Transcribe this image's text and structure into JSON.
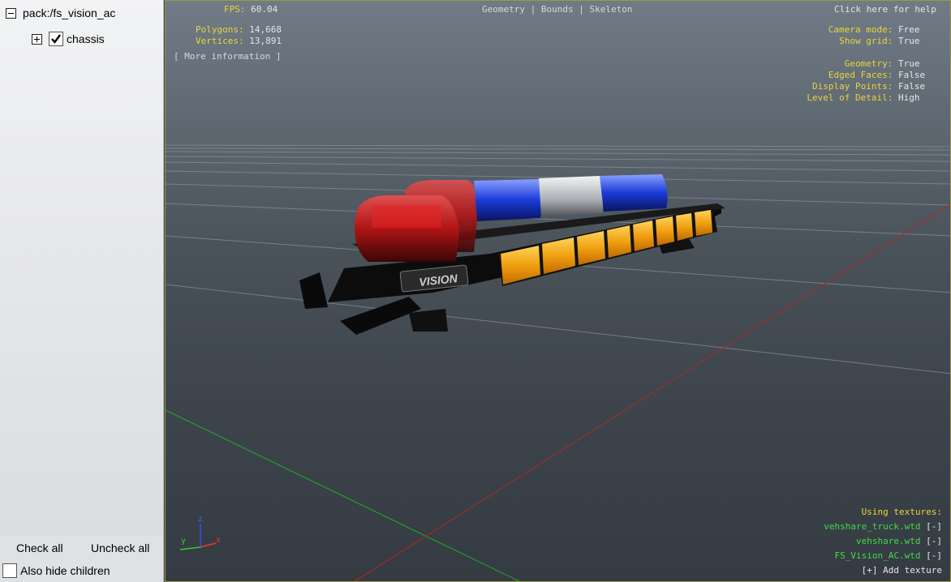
{
  "sidebar": {
    "root_label": "pack:/fs_vision_ac",
    "child_label": "chassis",
    "check_all": "Check all",
    "uncheck_all": "Uncheck all",
    "hide_children": "Also hide children"
  },
  "viewport": {
    "fps_label": "FPS:",
    "fps_value": "60.04",
    "polygons_label": "Polygons:",
    "polygons_value": "14,668",
    "vertices_label": "Vertices:",
    "vertices_value": "13,891",
    "more_info": "[ More information ]",
    "tabs": [
      "Geometry",
      "Bounds",
      "Skeleton"
    ],
    "tab_sep": "|",
    "help": "Click here for help",
    "camera_mode_label": "Camera mode:",
    "camera_mode_value": "Free",
    "show_grid_label": "Show grid:",
    "show_grid_value": "True",
    "geometry_label": "Geometry:",
    "geometry_value": "True",
    "edged_faces_label": "Edged Faces:",
    "edged_faces_value": "False",
    "display_points_label": "Display Points:",
    "display_points_value": "False",
    "lod_label": "Level of Detail:",
    "lod_value": "High",
    "using_textures": "Using textures:",
    "textures": [
      {
        "name": "vehshare_truck.wtd",
        "remove": "[-]"
      },
      {
        "name": "vehshare.wtd",
        "remove": "[-]"
      },
      {
        "name": "FS_Vision_AC.wtd",
        "remove": "[-]"
      }
    ],
    "add_texture": "[+] Add texture",
    "axis_x": "x",
    "axis_y": "y",
    "axis_z": "z",
    "model_brand": "VISION"
  },
  "colors": {
    "label_yellow": "#e8d53a",
    "texture_green": "#3fdc4a",
    "light_red": "#c81818",
    "light_blue": "#1f3fd8",
    "light_amber": "#f0a010"
  }
}
